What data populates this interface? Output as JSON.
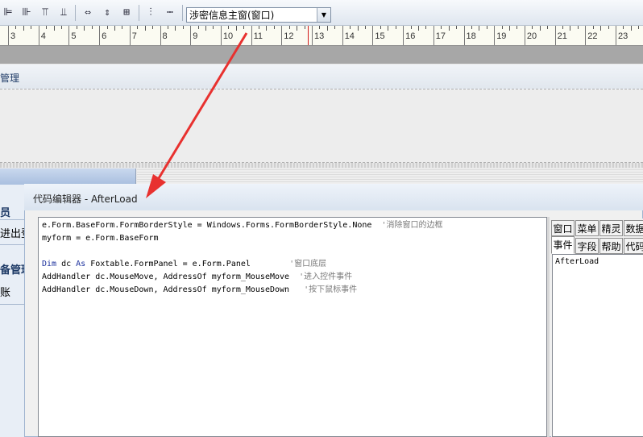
{
  "toolbar": {
    "icons": [
      {
        "name": "align-left-icon",
        "glyph": "⊫"
      },
      {
        "name": "align-right-icon",
        "glyph": "⊪"
      },
      {
        "name": "align-top-icon",
        "glyph": "⫪"
      },
      {
        "name": "align-bottom-icon",
        "glyph": "⫫"
      },
      {
        "name": "same-width-icon",
        "glyph": "⇔"
      },
      {
        "name": "same-height-icon",
        "glyph": "⇕"
      },
      {
        "name": "same-size-icon",
        "glyph": "⊞"
      },
      {
        "name": "vertical-spacing-icon",
        "glyph": "⫶"
      },
      {
        "name": "horizontal-spacing-icon",
        "glyph": "⋯"
      }
    ],
    "form_select_value": "涉密信息主窗(窗口)",
    "dropdown_arrow": "▼"
  },
  "ruler": {
    "labels": [
      "3",
      "4",
      "5",
      "6",
      "7",
      "8",
      "9",
      "10",
      "11",
      "12",
      "13",
      "14",
      "15",
      "16",
      "17",
      "18",
      "19",
      "20",
      "21",
      "22",
      "23"
    ]
  },
  "designer": {
    "strip_title": "管理"
  },
  "nav": {
    "items": [
      "员",
      "进出登",
      "备管理",
      "账"
    ]
  },
  "editor": {
    "title": "代码编辑器 - AfterLoad",
    "code_lines": [
      {
        "code": "e.Form.BaseForm.FormBorderStyle = Windows.Forms.FormBorderStyle.None  ",
        "comment": "'消除窗口的边框"
      },
      {
        "code": "myform = e.Form.BaseForm",
        "comment": ""
      },
      {
        "code": "",
        "comment": ""
      },
      {
        "kw1": "Dim",
        "mid1": " dc ",
        "kw2": "As",
        "code": " Foxtable.FormPanel = e.Form.Panel        ",
        "comment": "'窗口底层"
      },
      {
        "code": "AddHandler dc.MouseMove, AddressOf myform_MouseMove  ",
        "comment": "'进入控件事件"
      },
      {
        "code": "AddHandler dc.MouseDown, AddressOf myform_MouseDown   ",
        "comment": "'按下鼠标事件"
      }
    ],
    "tabs_row1": [
      "窗口",
      "菜单",
      "精灵",
      "数据"
    ],
    "tabs_row2": [
      "事件",
      "字段",
      "帮助",
      "代码"
    ],
    "event_item": "AfterLoad"
  },
  "colors": {
    "arrow": "#e8312f",
    "ruler_marker": "#d21a1a",
    "keyword": "#1a2f9c"
  }
}
